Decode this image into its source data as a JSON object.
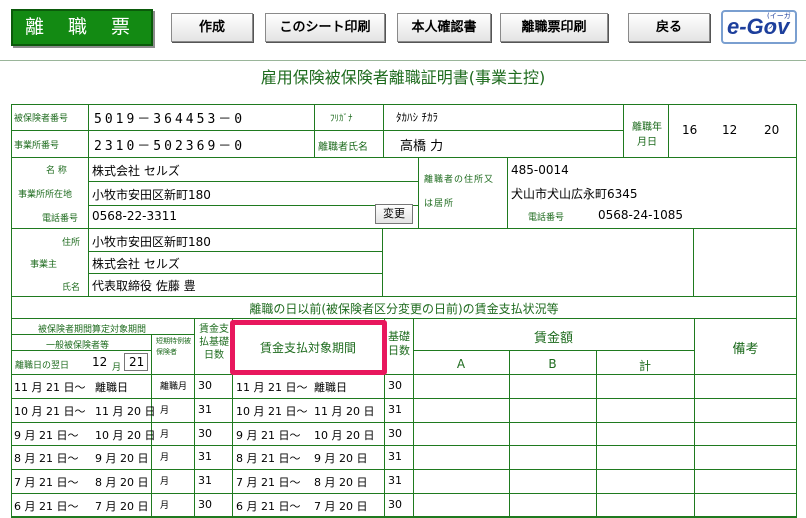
{
  "toolbar": {
    "form_tag": "離 職 票",
    "create": "作成",
    "print_sheet": "このシート印刷",
    "id_docs": "本人確認書",
    "print_form": "離職票印刷",
    "back": "戻る",
    "egov": "e-Gov",
    "egov_sub": "(イーガブ)"
  },
  "title": "雇用保険被保険者離職証明書(事業主控)",
  "header": {
    "insured_no_label": "被保険者番号",
    "insured_no": "5019－364453－0",
    "office_no_label": "事業所番号",
    "office_no": "2310－502369－0",
    "furigana_label": "ﾌﾘｶﾞﾅ",
    "furigana": "ﾀｶﾊｼ ﾁｶﾗ",
    "name_label": "離職者氏名",
    "name": "高橋 力",
    "leave_date_label": "離職年月日",
    "leave_y": "16",
    "leave_m": "12",
    "leave_d": "20"
  },
  "office": {
    "name_label": "名 称",
    "name": "株式会社 セルズ",
    "addr_label": "事業所所在地",
    "addr": "小牧市安田区新町180",
    "tel_label": "電話番号",
    "tel": "0568-22-3311",
    "change_btn": "変更"
  },
  "leaver": {
    "addr_label": "離職者の住所又は居所",
    "zip": "485-0014",
    "addr": "犬山市犬山広永町6345",
    "tel_label": "電話番号",
    "tel": "0568-24-1085"
  },
  "employer": {
    "addr_label": "住所",
    "addr": "小牧市安田区新町180",
    "label": "事業主",
    "company": "株式会社 セルズ",
    "person_label": "氏名",
    "person": "代表取締役 佐藤 豊"
  },
  "wage_section": {
    "title": "離職の日以前(被保険者区分変更の日前)の賃金支払状況等",
    "col_period_header": "被保険者期間算定対象期間",
    "col_general": "一般被保険者等",
    "col_day_after": "離職日の翌日",
    "day_after_m": "12",
    "day_after_d": "21",
    "col_short": "短期特例被保険者",
    "col_base_days": "賃金支払基礎日数",
    "col_pay_period": "賃金支払対象期間",
    "col_base_days2": "基礎日数",
    "col_amount": "賃金額",
    "col_a": "A",
    "col_b": "B",
    "col_total": "計",
    "col_note": "備考"
  },
  "rows": [
    {
      "from": "11 月 21 日～",
      "to": "離職日",
      "short": "離職月",
      "days": "30",
      "pfrom": "11 月 21 日～",
      "pto": "離職日",
      "pdays": "30"
    },
    {
      "from": "10 月 21 日～",
      "to": "11 月 20 日",
      "short": "月",
      "days": "31",
      "pfrom": "10 月 21 日～",
      "pto": "11 月 20 日",
      "pdays": "31"
    },
    {
      "from": "9 月 21 日～",
      "to": "10 月 20 日",
      "short": "月",
      "days": "30",
      "pfrom": "9 月 21 日～",
      "pto": "10 月 20 日",
      "pdays": "30"
    },
    {
      "from": "8 月 21 日～",
      "to": "9 月 20 日",
      "short": "月",
      "days": "31",
      "pfrom": "8 月 21 日～",
      "pto": "9 月 20 日",
      "pdays": "31"
    },
    {
      "from": "7 月 21 日～",
      "to": "8 月 20 日",
      "short": "月",
      "days": "31",
      "pfrom": "7 月 21 日～",
      "pto": "8 月 20 日",
      "pdays": "31"
    },
    {
      "from": "6 月 21 日～",
      "to": "7 月 20 日",
      "short": "月",
      "days": "30",
      "pfrom": "6 月 21 日～",
      "pto": "7 月 20 日",
      "pdays": "30"
    }
  ],
  "colors": {
    "accent_green": "#138a13",
    "highlight": "#e8175d",
    "line_green": "#1f7a1f"
  }
}
